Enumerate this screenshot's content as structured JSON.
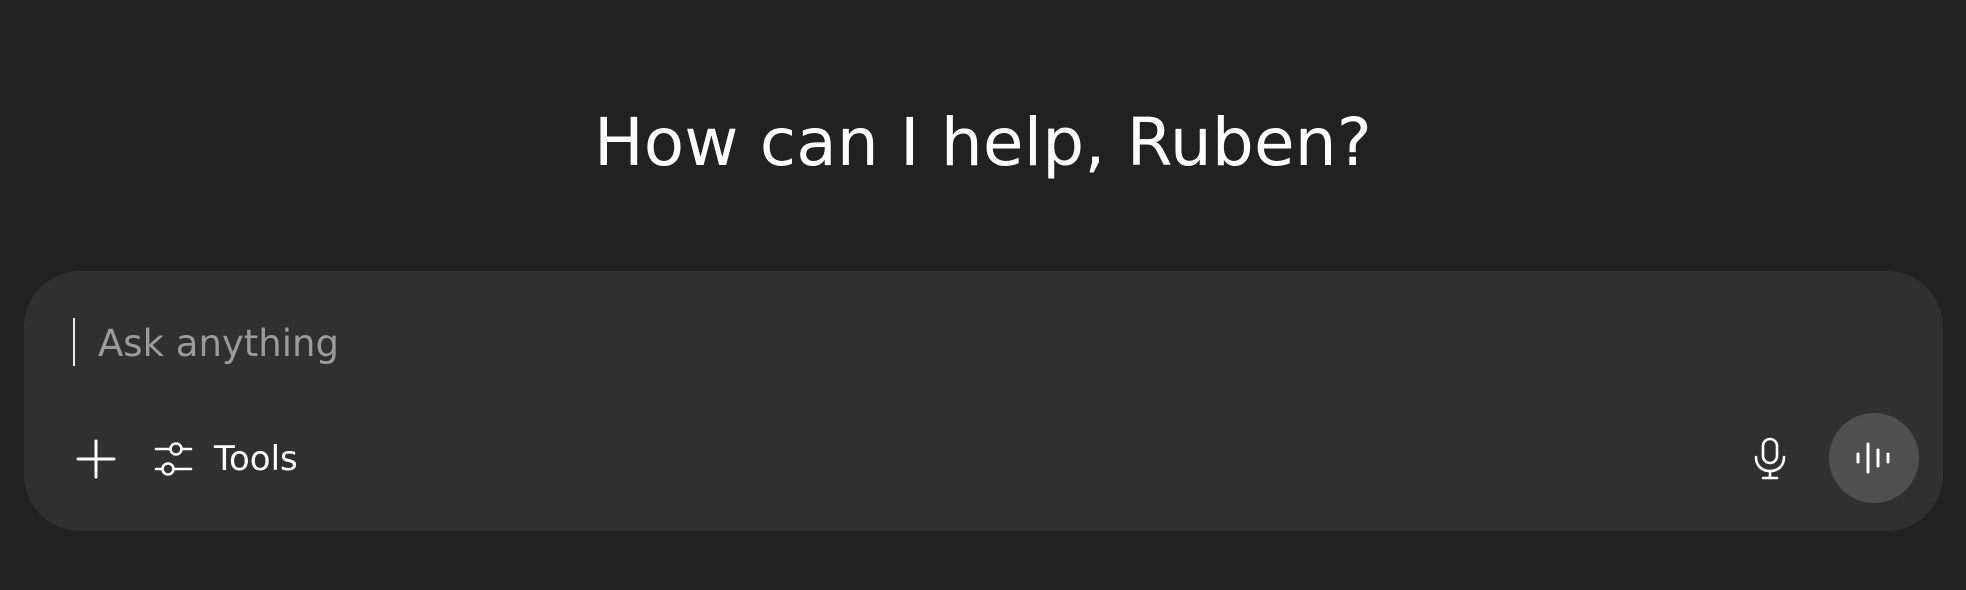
{
  "greeting": "How can I help, Ruben?",
  "composer": {
    "placeholder": "Ask anything",
    "value": "",
    "tools_label": "Tools",
    "icons": {
      "add": "plus-icon",
      "tools": "sliders-icon",
      "mic": "microphone-icon",
      "voice": "voice-waveform-icon"
    }
  },
  "colors": {
    "background": "#212121",
    "composer": "#303030",
    "voice_button": "#4f4f4f",
    "text": "#ffffff",
    "placeholder": "#9b9b9b"
  }
}
